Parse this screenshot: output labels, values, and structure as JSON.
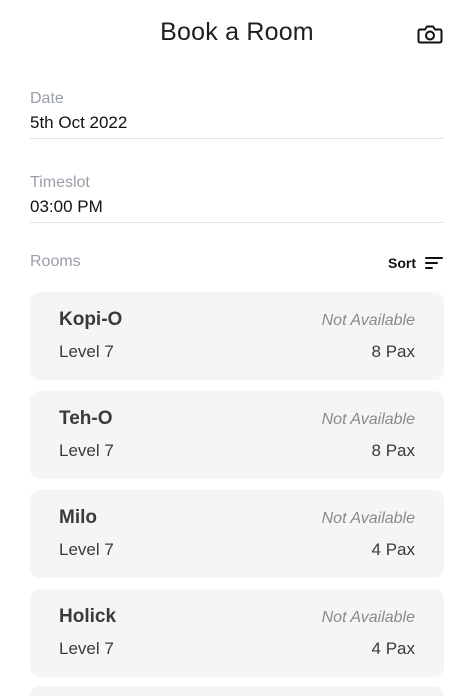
{
  "header": {
    "title": "Book a Room",
    "camera_icon": "camera-icon"
  },
  "date": {
    "label": "Date",
    "value": "5th Oct 2022"
  },
  "timeslot": {
    "label": "Timeslot",
    "value": "03:00 PM"
  },
  "rooms": {
    "label": "Rooms",
    "sort_label": "Sort",
    "sort_icon": "sort-icon",
    "items": [
      {
        "name": "Kopi-O",
        "level": "Level 7",
        "status": "Not Available",
        "pax": "8 Pax"
      },
      {
        "name": "Teh-O",
        "level": "Level 7",
        "status": "Not Available",
        "pax": "8 Pax"
      },
      {
        "name": "Milo",
        "level": "Level 7",
        "status": "Not Available",
        "pax": "4 Pax"
      },
      {
        "name": "Holick",
        "level": "Level 7",
        "status": "Not Available",
        "pax": "4 Pax"
      }
    ]
  }
}
